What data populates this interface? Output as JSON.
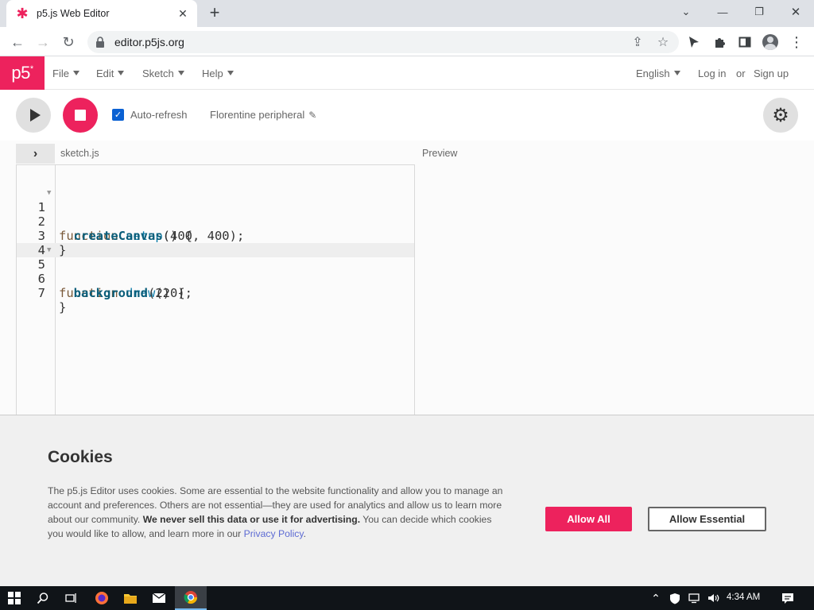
{
  "browser": {
    "tab_title": "p5.js Web Editor",
    "tab_close": "✕",
    "new_tab": "+",
    "url": "editor.p5js.org",
    "window_controls": {
      "minimize": "⌄",
      "min": "—",
      "restore": "❐",
      "close": "✕"
    }
  },
  "header": {
    "logo": "p5",
    "logo_star": "*",
    "menus": [
      "File",
      "Edit",
      "Sketch",
      "Help"
    ],
    "language": "English",
    "login": "Log in",
    "or": "or",
    "signup": "Sign up"
  },
  "controls": {
    "auto_refresh_label": "Auto-refresh",
    "auto_refresh_checked": true,
    "sketch_name": "Florentine peripheral"
  },
  "editor": {
    "filename": "sketch.js",
    "preview_label": "Preview",
    "lines": [
      {
        "num": "1",
        "fold": true
      },
      {
        "num": "2",
        "fold": false
      },
      {
        "num": "3",
        "fold": false
      },
      {
        "num": "4",
        "fold": false
      },
      {
        "num": "5",
        "fold": true
      },
      {
        "num": "6",
        "fold": false
      },
      {
        "num": "7",
        "fold": false
      }
    ],
    "code": {
      "l1_kw": "function",
      "l1_fn": "setup",
      "l1_rest": "() {",
      "l2_call": "createCanvas",
      "l2_rest": "(400, 400);",
      "l3": "}",
      "l5_kw": "function",
      "l5_fn": "draw",
      "l5_rest": "() {",
      "l6_call": "background",
      "l6_rest": "(220);",
      "l7": "}"
    }
  },
  "cookies": {
    "title": "Cookies",
    "text_1": "The p5.js Editor uses cookies. Some are essential to the website functionality and allow you to manage an account and preferences. Others are not essential—they are used for analytics and allow us to learn more about our community. ",
    "text_bold": "We never sell this data or use it for advertising.",
    "text_2": " You can decide which cookies you would like to allow, and learn more in our ",
    "privacy_link": "Privacy Policy",
    "text_end": ".",
    "allow_all": "Allow All",
    "allow_essential": "Allow Essential"
  },
  "taskbar": {
    "time": "4:34 AM"
  },
  "colors": {
    "accent": "#ed225d",
    "checkbox": "#0b61d3"
  }
}
